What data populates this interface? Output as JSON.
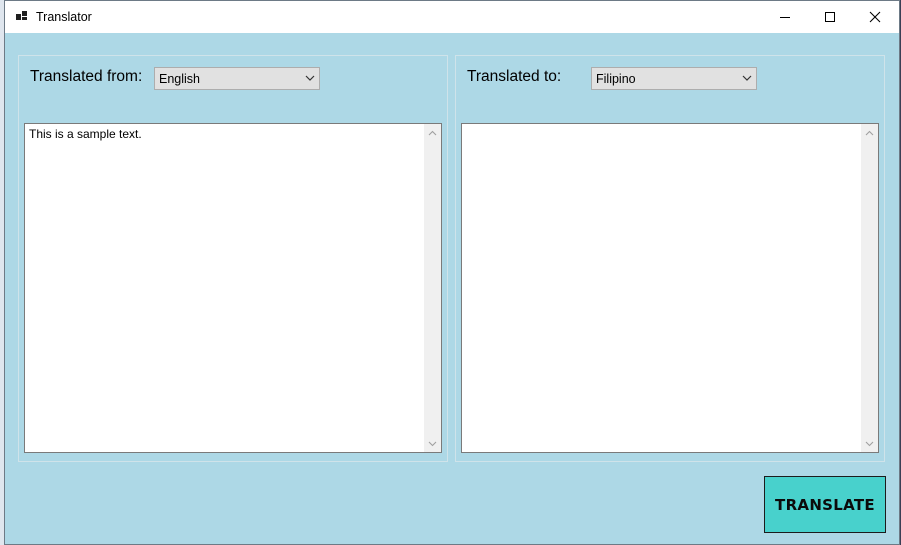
{
  "window": {
    "title": "Translator",
    "minimize_icon": "minimize-icon",
    "maximize_icon": "maximize-icon",
    "close_icon": "close-icon"
  },
  "source": {
    "label": "Translated from:",
    "language": "English",
    "text": "This is a sample text."
  },
  "target": {
    "label": "Translated to:",
    "language": "Filipino",
    "text": ""
  },
  "actions": {
    "translate_label": "TRANSLATE"
  },
  "colors": {
    "window_background": "#add8e6",
    "translate_button": "#48d1cc"
  }
}
